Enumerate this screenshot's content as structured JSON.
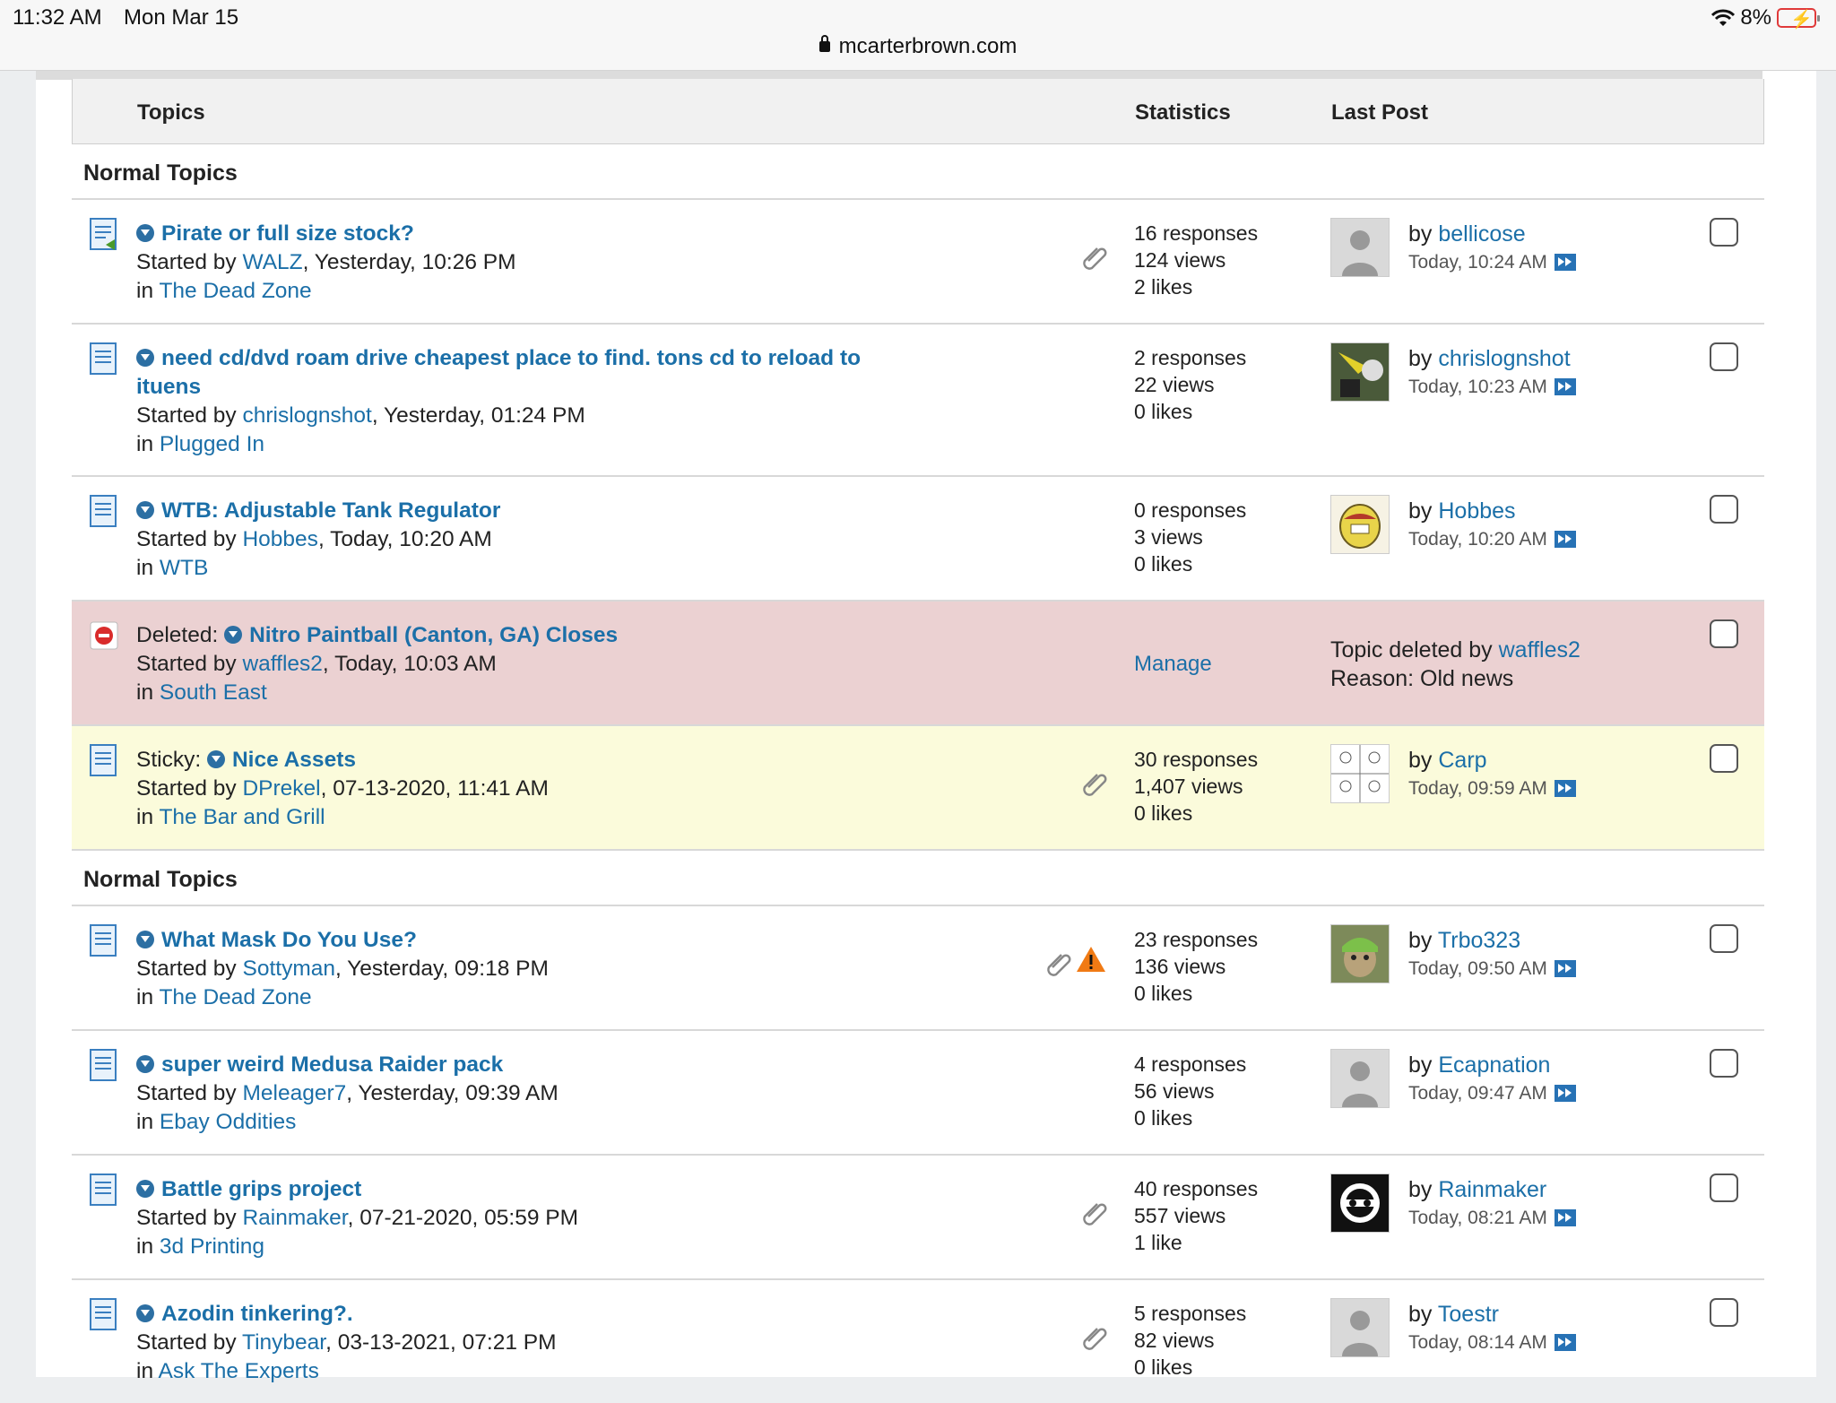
{
  "status_bar": {
    "time": "11:32 AM",
    "date": "Mon Mar 15",
    "battery": "8%",
    "url": "mcarterbrown.com"
  },
  "table_header": {
    "topics": "Topics",
    "statistics": "Statistics",
    "last_post": "Last Post"
  },
  "sections": {
    "first": "Normal Topics",
    "second": "Normal Topics"
  },
  "rows": [
    {
      "title": "Pirate or full size stock?",
      "started_prefix": "Started by ",
      "author": "WALZ",
      "started_time": ", Yesterday, 10:26 PM",
      "in_prefix": "in ",
      "forum": "The Dead Zone",
      "responses": "16 responses",
      "views": "124 views",
      "likes": "2 likes",
      "last_by_prefix": "by ",
      "last_user": "bellicose",
      "last_time": "Today, 10:24 AM",
      "avatar": "default-avatar"
    },
    {
      "title": "need cd/dvd roam drive cheapest place to find. tons cd to reload to ituens",
      "started_prefix": "Started by ",
      "author": "chrislognshot",
      "started_time": ", Yesterday, 01:24 PM",
      "in_prefix": "in ",
      "forum": "Plugged In",
      "responses": "2 responses",
      "views": "22 views",
      "likes": "0 likes",
      "last_by_prefix": "by ",
      "last_user": "chrislognshot",
      "last_time": "Today, 10:23 AM",
      "avatar": "photo-avatar"
    },
    {
      "title": "WTB: Adjustable Tank Regulator",
      "started_prefix": "Started by ",
      "author": "Hobbes",
      "started_time": ", Today, 10:20 AM",
      "in_prefix": "in ",
      "forum": "WTB",
      "responses": "0 responses",
      "views": "3 views",
      "likes": "0 likes",
      "last_by_prefix": "by ",
      "last_user": "Hobbes",
      "last_time": "Today, 10:20 AM",
      "avatar": "cartoon-avatar"
    },
    {
      "deleted_label": "Deleted: ",
      "title": "Nitro Paintball (Canton, GA) Closes",
      "started_prefix": "Started by ",
      "author": "waffles2",
      "started_time": ", Today, 10:03 AM",
      "in_prefix": "in ",
      "forum": "South East",
      "manage": "Manage",
      "deleted_by_prefix": "Topic deleted by ",
      "deleted_by": "waffles2",
      "reason": "Reason: Old news"
    },
    {
      "sticky_label": "Sticky: ",
      "title": "Nice Assets",
      "started_prefix": "Started by ",
      "author": "DPrekel",
      "started_time": ", 07-13-2020, 11:41 AM",
      "in_prefix": "in ",
      "forum": "The Bar and Grill",
      "responses": "30 responses",
      "views": "1,407 views",
      "likes": "0 likes",
      "last_by_prefix": "by ",
      "last_user": "Carp",
      "last_time": "Today, 09:59 AM",
      "avatar": "sketch-avatar"
    },
    {
      "title": "What Mask Do You Use?",
      "started_prefix": "Started by ",
      "author": "Sottyman",
      "started_time": ", Yesterday, 09:18 PM",
      "in_prefix": "in ",
      "forum": "The Dead Zone",
      "responses": "23 responses",
      "views": "136 views",
      "likes": "0 likes",
      "last_by_prefix": "by ",
      "last_user": "Trbo323",
      "last_time": "Today, 09:50 AM",
      "avatar": "cat-avatar"
    },
    {
      "title": "super weird Medusa Raider pack",
      "started_prefix": "Started by ",
      "author": "Meleager7",
      "started_time": ", Yesterday, 09:39 AM",
      "in_prefix": "in ",
      "forum": "Ebay Oddities",
      "responses": "4 responses",
      "views": "56 views",
      "likes": "0 likes",
      "last_by_prefix": "by ",
      "last_user": "Ecapnation",
      "last_time": "Today, 09:47 AM",
      "avatar": "default-avatar"
    },
    {
      "title": "Battle grips project",
      "started_prefix": "Started by ",
      "author": "Rainmaker",
      "started_time": ", 07-21-2020, 05:59 PM",
      "in_prefix": "in ",
      "forum": "3d Printing",
      "responses": "40 responses",
      "views": "557 views",
      "likes": "1 like",
      "last_by_prefix": "by ",
      "last_user": "Rainmaker",
      "last_time": "Today, 08:21 AM",
      "avatar": "logo-avatar"
    },
    {
      "title": "Azodin tinkering?.",
      "started_prefix": "Started by ",
      "author": "Tinybear",
      "started_time": ", 03-13-2021, 07:21 PM",
      "in_prefix": "in ",
      "forum": "Ask The Experts",
      "responses": "5 responses",
      "views": "82 views",
      "likes": "0 likes",
      "last_by_prefix": "by ",
      "last_user": "Toestr",
      "last_time": "Today, 08:14 AM",
      "avatar": "default-avatar"
    }
  ]
}
